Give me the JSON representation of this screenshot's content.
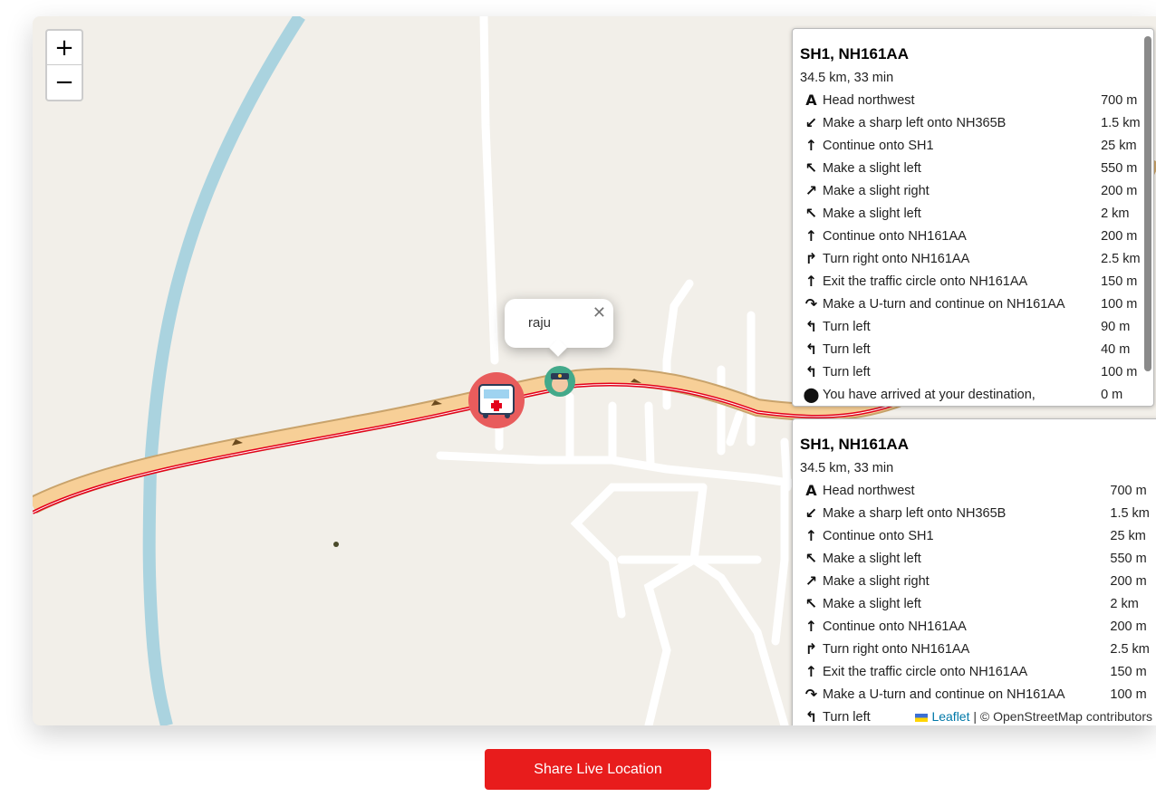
{
  "map": {
    "zoom_in": "+",
    "zoom_out": "−",
    "popup": {
      "text": "raju",
      "close": "✕"
    },
    "markers": [
      {
        "name": "ambulance-marker",
        "icon": "ambulance-icon",
        "color": "#e85c5c"
      },
      {
        "name": "police-marker",
        "icon": "police-officer-icon",
        "color": "#43a98a"
      }
    ],
    "route_color": "#e3001b",
    "road_color": "#f7cf97"
  },
  "routes": [
    {
      "title": "SH1, NH161AA",
      "summary": "34.5 km, 33 min",
      "steps": [
        {
          "icon": "A",
          "text": "Head northwest",
          "distance": "700 m"
        },
        {
          "icon": "↙",
          "text": "Make a sharp left onto NH365B",
          "distance": "1.5 km"
        },
        {
          "icon": "↑",
          "text": "Continue onto SH1",
          "distance": "25 km"
        },
        {
          "icon": "↖",
          "text": "Make a slight left",
          "distance": "550 m"
        },
        {
          "icon": "↗",
          "text": "Make a slight right",
          "distance": "200 m"
        },
        {
          "icon": "↖",
          "text": "Make a slight left",
          "distance": "2 km"
        },
        {
          "icon": "↑",
          "text": "Continue onto NH161AA",
          "distance": "200 m"
        },
        {
          "icon": "↱",
          "text": "Turn right onto NH161AA",
          "distance": "2.5 km"
        },
        {
          "icon": "↑",
          "text": "Exit the traffic circle onto NH161AA",
          "distance": "150 m"
        },
        {
          "icon": "↷",
          "text": "Make a U-turn and continue on NH161AA",
          "distance": "100 m"
        },
        {
          "icon": "↰",
          "text": "Turn left",
          "distance": "90 m"
        },
        {
          "icon": "↰",
          "text": "Turn left",
          "distance": "40 m"
        },
        {
          "icon": "↰",
          "text": "Turn left",
          "distance": "100 m"
        },
        {
          "icon": "⬤",
          "text": "You have arrived at your destination,",
          "distance": "0 m"
        }
      ]
    },
    {
      "title": "SH1, NH161AA",
      "summary": "34.5 km, 33 min",
      "steps": [
        {
          "icon": "A",
          "text": "Head northwest",
          "distance": "700 m"
        },
        {
          "icon": "↙",
          "text": "Make a sharp left onto NH365B",
          "distance": "1.5 km"
        },
        {
          "icon": "↑",
          "text": "Continue onto SH1",
          "distance": "25 km"
        },
        {
          "icon": "↖",
          "text": "Make a slight left",
          "distance": "550 m"
        },
        {
          "icon": "↗",
          "text": "Make a slight right",
          "distance": "200 m"
        },
        {
          "icon": "↖",
          "text": "Make a slight left",
          "distance": "2 km"
        },
        {
          "icon": "↑",
          "text": "Continue onto NH161AA",
          "distance": "200 m"
        },
        {
          "icon": "↱",
          "text": "Turn right onto NH161AA",
          "distance": "2.5 km"
        },
        {
          "icon": "↑",
          "text": "Exit the traffic circle onto NH161AA",
          "distance": "150 m"
        },
        {
          "icon": "↷",
          "text": "Make a U-turn and continue on NH161AA",
          "distance": "100 m"
        },
        {
          "icon": "↰",
          "text": "Turn left",
          "distance": ""
        }
      ]
    }
  ],
  "attribution": {
    "leaflet": "Leaflet",
    "rest": " | © OpenStreetMap contributors"
  },
  "share_button": "Share Live Location"
}
